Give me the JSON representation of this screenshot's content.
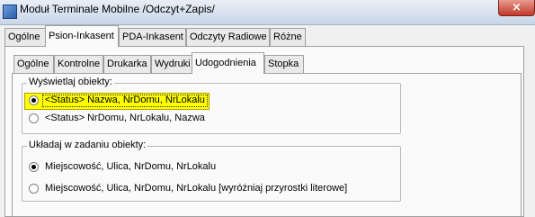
{
  "window": {
    "title": "Moduł Terminale Mobilne /Odczyt+Zapis/",
    "close_glyph": "×"
  },
  "main_tabs": [
    {
      "label": "Ogólne"
    },
    {
      "label": "Psion-Inkasent"
    },
    {
      "label": "PDA-Inkasent"
    },
    {
      "label": "Odczyty Radiowe"
    },
    {
      "label": "Różne"
    }
  ],
  "sub_tabs": [
    {
      "label": "Ogólne"
    },
    {
      "label": "Kontrolne"
    },
    {
      "label": "Drukarka"
    },
    {
      "label": "Wydruki"
    },
    {
      "label": "Udogodnienia"
    },
    {
      "label": "Stopka"
    }
  ],
  "group_display": {
    "legend": "Wyświetlaj obiekty:",
    "options": [
      {
        "label": "<Status> Nazwa, NrDomu, NrLokalu",
        "checked": true
      },
      {
        "label": "<Status> NrDomu, NrLokalu, Nazwa",
        "checked": false
      }
    ]
  },
  "group_order": {
    "legend": "Układaj w zadaniu obiekty:",
    "options": [
      {
        "label": "Miejscowość, Ulica, NrDomu, NrLokalu",
        "checked": true
      },
      {
        "label": "Miejscowość, Ulica, NrDomu, NrLokalu [wyróżniaj przyrostki literowe]",
        "checked": false
      }
    ]
  },
  "colors": {
    "highlight": "#ffff00",
    "close_button": "#c2382a"
  },
  "icons": {
    "app": "app-window-icon",
    "close": "close-icon"
  }
}
